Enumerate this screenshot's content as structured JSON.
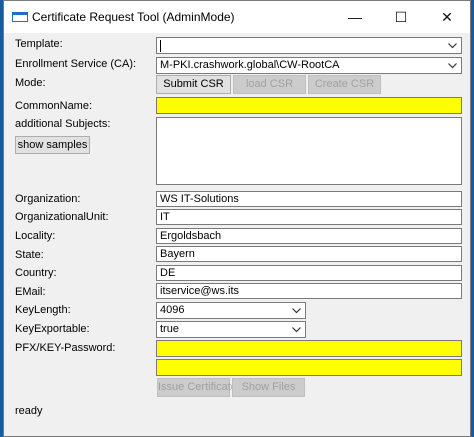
{
  "window": {
    "title": "Certificate Request Tool (AdminMode)",
    "minimize_glyph": "—",
    "maximize_glyph": "☐",
    "close_glyph": "✕"
  },
  "labels": {
    "template": "Template:",
    "enrollment_service": "Enrollment Service (CA):",
    "mode": "Mode:",
    "common_name": "CommonName:",
    "additional_subjects": "additional Subjects:",
    "organization": "Organization:",
    "organizational_unit": "OrganizationalUnit:",
    "locality": "Locality:",
    "state": "State:",
    "country": "Country:",
    "email": "EMail:",
    "key_length": "KeyLength:",
    "key_exportable": "KeyExportable:",
    "pfx_password": "PFX/KEY-Password:"
  },
  "fields": {
    "template": "",
    "enrollment_service": "M-PKI.crashwork.global\\CW-RootCA",
    "common_name": "",
    "additional_subjects": "",
    "organization": "WS IT-Solutions",
    "organizational_unit": "IT",
    "locality": "Ergoldsbach",
    "state": "Bayern",
    "country": "DE",
    "email": "itservice@ws.its",
    "key_length": "4096",
    "key_exportable": "true",
    "pfx_password": "",
    "pfx_password_confirm": ""
  },
  "buttons": {
    "submit_csr": "Submit CSR",
    "load_csr": "load CSR",
    "create_csr": "Create CSR",
    "show_samples": "show samples",
    "issue_certificate": "Issue Certificate",
    "show_files": "Show Files"
  },
  "status": "ready",
  "colors": {
    "required_field": "#ffff00",
    "desktop": "#1a5a9a"
  },
  "icons": {
    "dropdown": "chevron-down-icon",
    "app": "app-window-icon"
  }
}
